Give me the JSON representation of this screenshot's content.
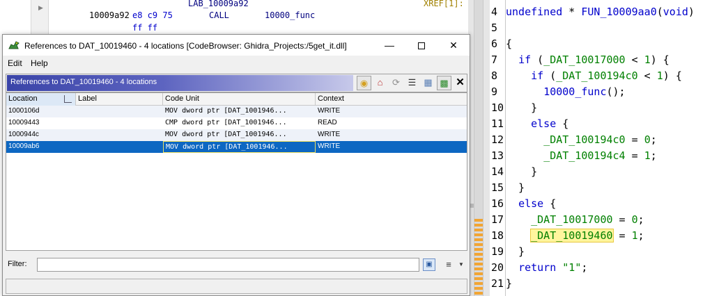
{
  "listing": {
    "label": "LAB_10009a92",
    "xref": "XREF[1]:",
    "address": "10009a92",
    "bytes": "e8 c9 75",
    "mnemonic": "CALL",
    "operand": "10000_func",
    "bytes_cont": "ff ff"
  },
  "dialog": {
    "title": "References to DAT_10019460 - 4 locations [CodeBrowser: Ghidra_Projects:/5get_it.dll]",
    "menu": {
      "edit": "Edit",
      "help": "Help"
    },
    "panel_title": "References to DAT_10019460 - 4 locations",
    "columns": [
      "Location",
      "Label",
      "Code Unit",
      "Context"
    ],
    "rows": [
      {
        "location": "1000106d",
        "label": "",
        "code_unit": "MOV dword ptr [DAT_1001946...",
        "context": "WRITE"
      },
      {
        "location": "10009443",
        "label": "",
        "code_unit": "CMP dword ptr [DAT_1001946...",
        "context": "READ"
      },
      {
        "location": "1000944c",
        "label": "",
        "code_unit": "MOV dword ptr [DAT_1001946...",
        "context": "WRITE"
      },
      {
        "location": "10009ab6",
        "label": "",
        "code_unit": "MOV dword ptr [DAT_1001946...",
        "context": "WRITE"
      }
    ],
    "selected_row": 3,
    "filter_label": "Filter:",
    "filter_value": ""
  },
  "decompiler": {
    "lines": [
      {
        "n": "4",
        "t": "undefined * FUN_10009aa0(void)"
      },
      {
        "n": "5",
        "t": ""
      },
      {
        "n": "6",
        "t": "{"
      },
      {
        "n": "7",
        "t": "  if (_DAT_10017000 < 1) {"
      },
      {
        "n": "8",
        "t": "    if (_DAT_100194c0 < 1) {"
      },
      {
        "n": "9",
        "t": "      10000_func();"
      },
      {
        "n": "10",
        "t": "    }"
      },
      {
        "n": "11",
        "t": "    else {"
      },
      {
        "n": "12",
        "t": "      _DAT_100194c0 = 0;"
      },
      {
        "n": "13",
        "t": "      _DAT_100194c4 = 1;"
      },
      {
        "n": "14",
        "t": "    }"
      },
      {
        "n": "15",
        "t": "  }"
      },
      {
        "n": "16",
        "t": "  else {"
      },
      {
        "n": "17",
        "t": "    _DAT_10017000 = 0;"
      },
      {
        "n": "18",
        "t": "    _DAT_10019460 = 1;"
      },
      {
        "n": "19",
        "t": "  }"
      },
      {
        "n": "20",
        "t": "  return \"1\";"
      },
      {
        "n": "21",
        "t": "}"
      }
    ],
    "highlight_token": "_DAT_10019460"
  },
  "colors": {
    "selection": "#0d67c2",
    "highlight": "#fff59d",
    "keyword": "#0000cc",
    "global": "#008000",
    "marker": "#f2a533"
  }
}
